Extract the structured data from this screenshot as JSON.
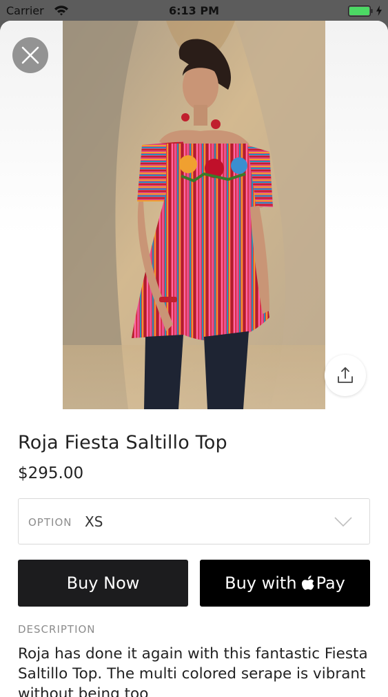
{
  "status_bar": {
    "carrier": "Carrier",
    "time": "6:13 PM",
    "icons": [
      "wifi-icon",
      "battery-icon",
      "charging-icon"
    ],
    "battery_color": "#4cd964"
  },
  "product": {
    "image_alt": "Model wearing the Roja Fiesta Saltillo Top",
    "title": "Roja Fiesta Saltillo Top",
    "price": "$295.00",
    "option": {
      "label": "OPTION",
      "value": "XS"
    },
    "buttons": {
      "buy_now": "Buy Now",
      "apple_pay_prefix": "Buy with",
      "apple_pay_suffix": "Pay"
    },
    "description": {
      "heading": "DESCRIPTION",
      "body": "Roja has done it again with this fantastic Fiesta Saltillo Top. The multi colored serape is vibrant without being too"
    }
  },
  "controls": {
    "close_icon": "close-icon",
    "share_icon": "share-icon"
  },
  "colors": {
    "primary_button": "#1c1c1e",
    "apple_pay_button": "#000000",
    "muted_text": "#8c8c8c"
  }
}
